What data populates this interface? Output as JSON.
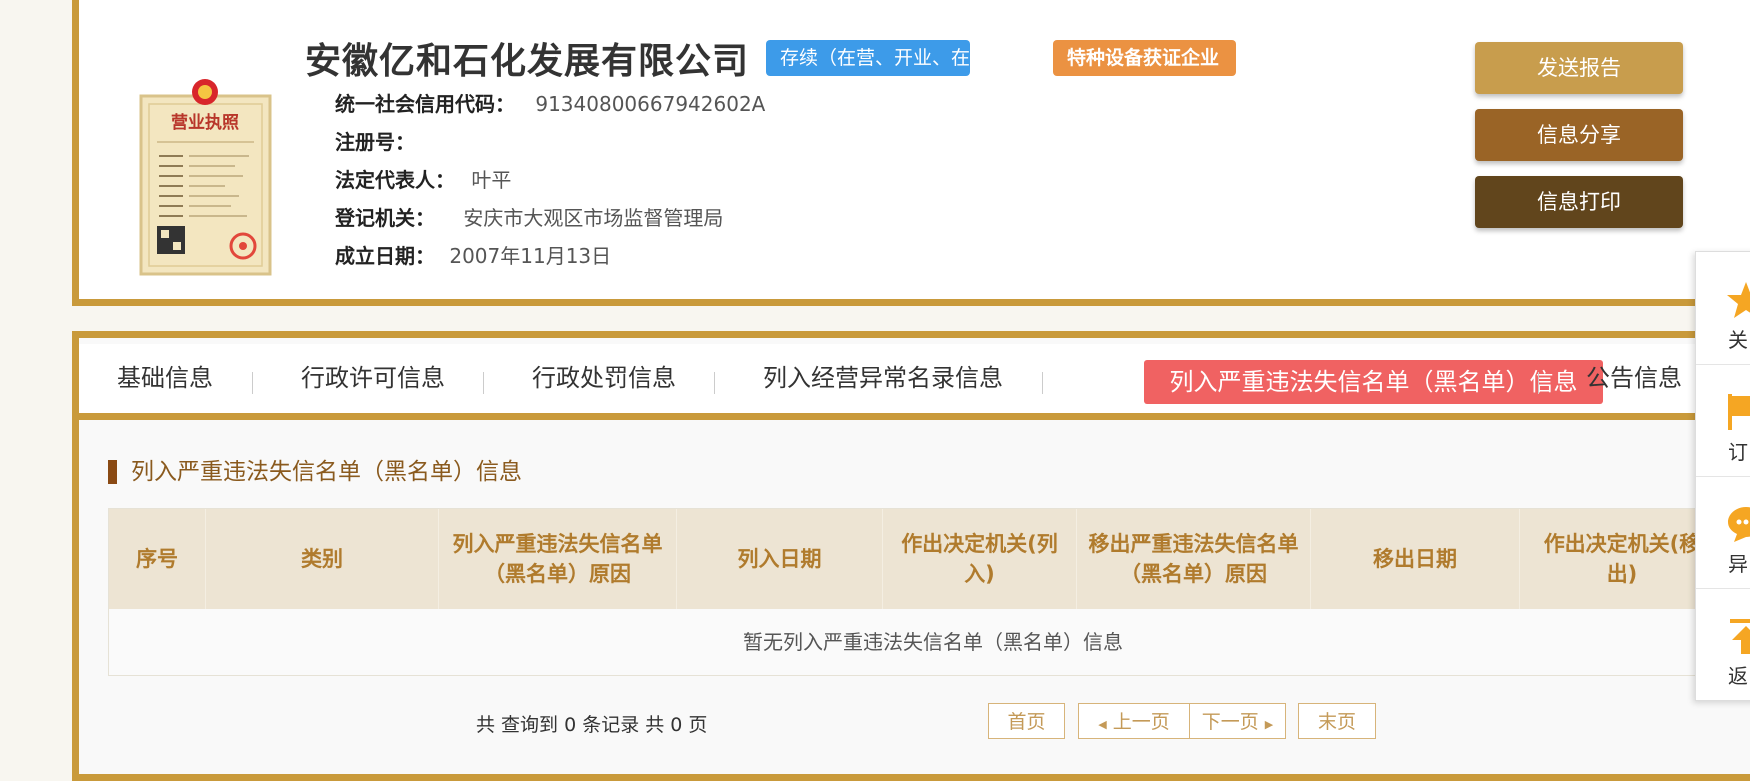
{
  "company": {
    "name": "安徽亿和石化发展有限公司",
    "status_badge": "存续（在营、开业、在册）",
    "special_badge": "特种设备获证企业",
    "license_title": "营业执照"
  },
  "info": {
    "credit_code_label": "统一社会信用代码：",
    "credit_code_value": "91340800667942602A",
    "reg_no_label": "注册号：",
    "reg_no_value": "",
    "legal_rep_label": "法定代表人：",
    "legal_rep_value": "叶平",
    "authority_label": "登记机关：",
    "authority_value": "安庆市大观区市场监督管理局",
    "date_label": "成立日期：",
    "date_value": "2007年11月13日"
  },
  "actions": {
    "send": "发送报告",
    "share": "信息分享",
    "print": "信息打印"
  },
  "tabs": [
    "基础信息",
    "行政许可信息",
    "行政处罚信息",
    "列入经营异常名录信息",
    "列入严重违法失信名单（黑名单）信息",
    "公告信息"
  ],
  "section": {
    "title": "列入严重违法失信名单（黑名单）信息"
  },
  "table": {
    "headers": [
      "序号",
      "类别",
      "列入严重违法失信名单（黑名单）原因",
      "列入日期",
      "作出决定机关(列入)",
      "移出严重违法失信名单（黑名单）原因",
      "移出日期",
      "作出决定机关(移出)"
    ],
    "empty_text": "暂无列入严重违法失信名单（黑名单）信息"
  },
  "pager": {
    "info": "共 查询到 0 条记录 共 0 页",
    "first": "首页",
    "prev": "上一页",
    "next": "下一页",
    "last": "末页"
  },
  "side_panel": {
    "items": [
      "关",
      "订",
      "异",
      "返"
    ],
    "icons": [
      "star-icon",
      "flag-icon",
      "chat-icon",
      "back-top-icon"
    ],
    "accent": "#f5a623"
  },
  "colors": {
    "gold_border": "#c99a3b",
    "active_tab": "#f06262",
    "status_badge": "#3d9be9",
    "special_badge": "#eb9242"
  }
}
